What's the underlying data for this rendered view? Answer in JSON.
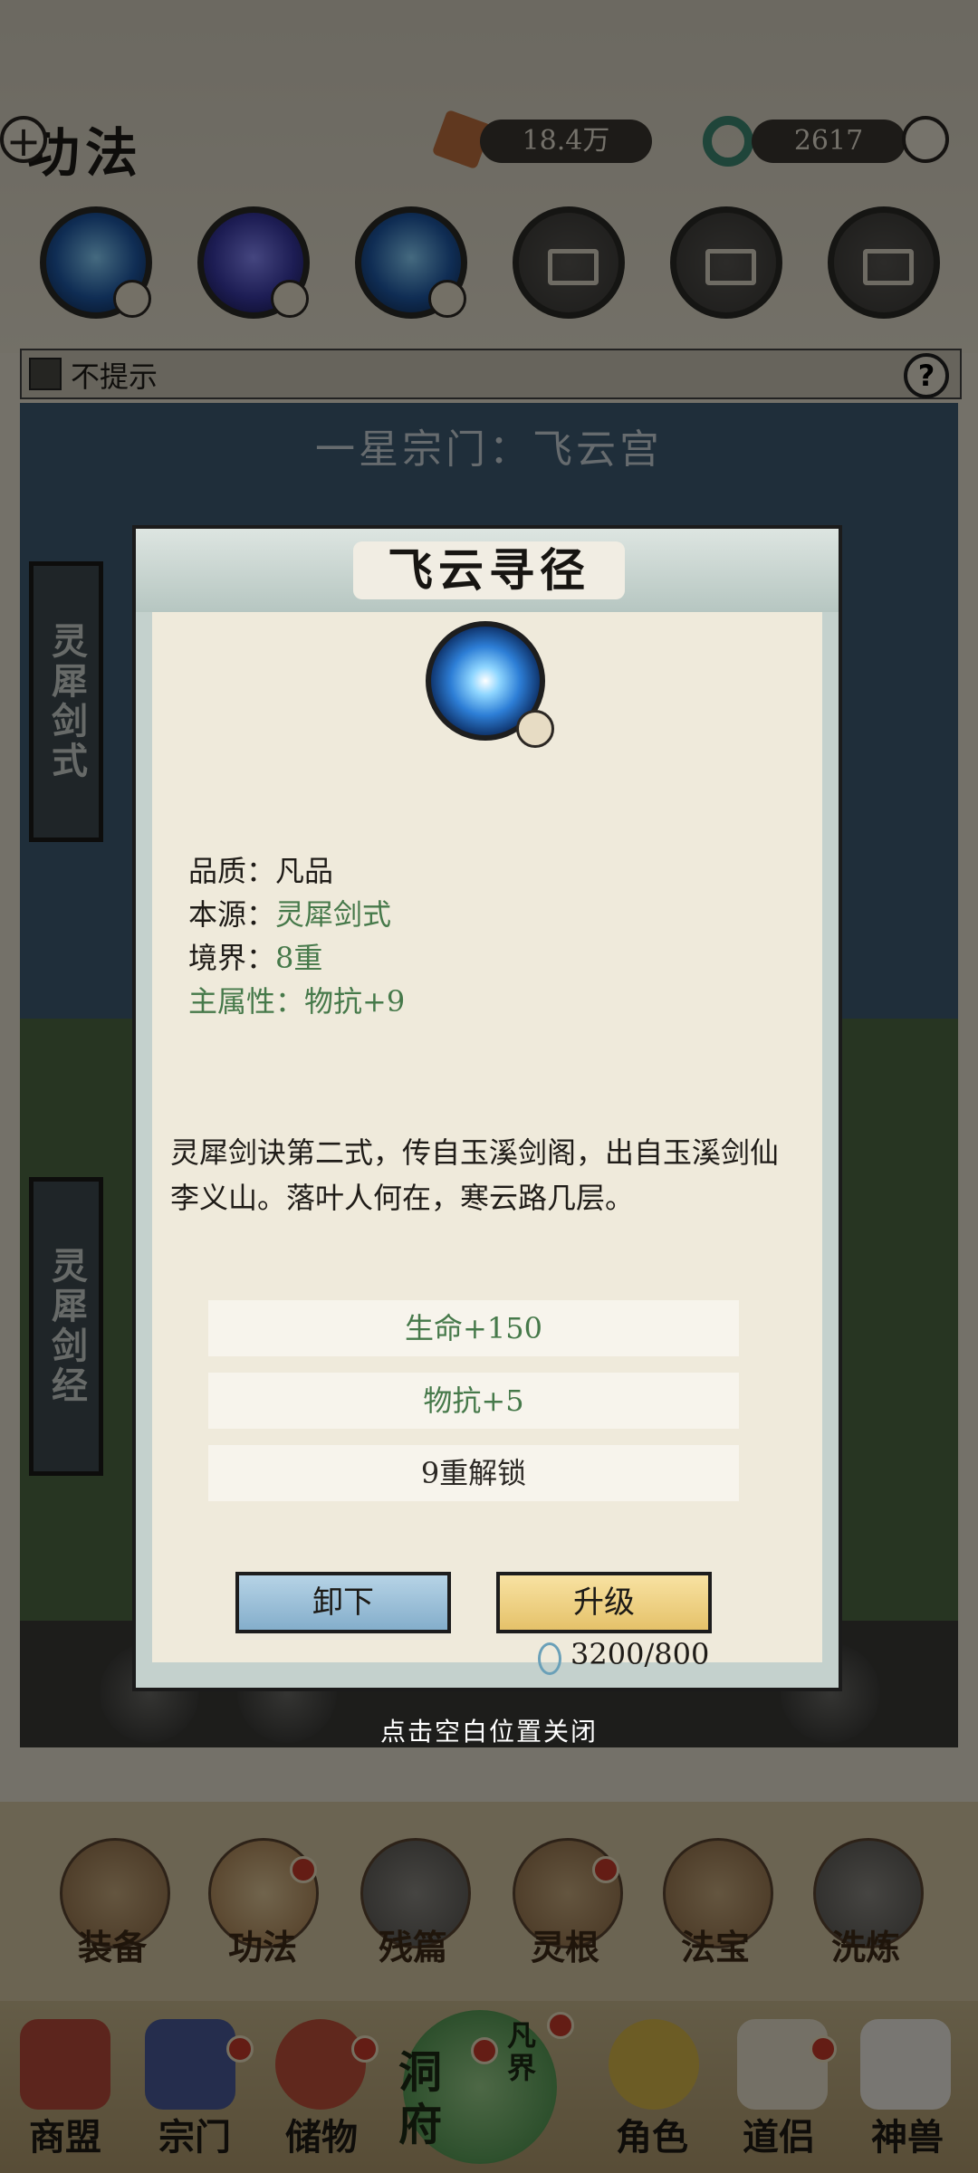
{
  "header": {
    "title": "功法",
    "spirit_stone": "18.4万",
    "jade": "2617"
  },
  "hint": {
    "label": "不提示",
    "help": "?"
  },
  "sect": {
    "title": "一星宗门：飞云宫",
    "side_tabs": [
      "灵犀剑式",
      "灵犀剑经"
    ]
  },
  "dialog": {
    "title": "飞云寻径",
    "quality_label": "品质：",
    "quality_value": "凡品",
    "source_label": "本源：",
    "source_value": "灵犀剑式",
    "realm_label": "境界：",
    "realm_value": "8重",
    "main_attr_label": "主属性：",
    "main_attr_value": "物抗+9",
    "description": "灵犀剑诀第二式，传自玉溪剑阁，出自玉溪剑仙李义山。落叶人何在，寒云路几层。",
    "attributes": [
      {
        "text": "生命+150",
        "color": "#46794a"
      },
      {
        "text": "物抗+5",
        "color": "#46794a"
      },
      {
        "text": "9重解锁",
        "color": "#2b2824"
      }
    ],
    "unload_label": "卸下",
    "upgrade_label": "升级",
    "cost": "3200/800"
  },
  "close_hint": "点击空白位置关闭",
  "sub_tabs": [
    "装备",
    "功法",
    "残篇",
    "灵根",
    "法宝",
    "洗炼"
  ],
  "nav": {
    "items": [
      "商盟",
      "宗门",
      "储物",
      "角色",
      "道侣",
      "神兽"
    ],
    "center_label": "洞府",
    "center_sub": "凡界"
  }
}
